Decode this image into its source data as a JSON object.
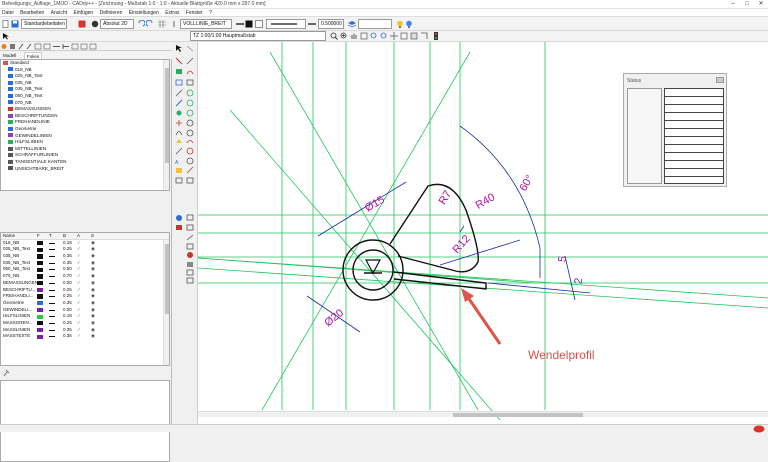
{
  "window": {
    "title": "Befestigungs_Auflage_1MOD - CADdy++ - [Zeichnung - Maßstab 1:0 : 1:0 - Aktuelle Blattgröße 420.0 mm x 297.0 mm]",
    "minimize_label": "–",
    "maximize_label": "□",
    "close_label": "✕"
  },
  "menu": [
    "Datei",
    "Bearbeiten",
    "Ansicht",
    "Einfügen",
    "Definieren",
    "Einstellungen",
    "Extras",
    "Fenster",
    "?"
  ],
  "toolbar": {
    "layer_select": "Standardebeitaten",
    "coord_select": "Absolut 2D",
    "linestyle_select": "VOLLLINIE_BREIT",
    "linewidth_value": "0.500000"
  },
  "toolbar2": {
    "scale_select": "TZ 1:00/1:00 Hauptmaßstab"
  },
  "panel": {
    "tabs": [
      "Modell",
      "Folien"
    ],
    "tree_items": [
      {
        "label": "Standard",
        "color": "#d9534f",
        "indent": 0
      },
      {
        "label": "018_NB",
        "color": "#2b6cd4",
        "indent": 1
      },
      {
        "label": "025_NB_Text",
        "color": "#2b6cd4",
        "indent": 1
      },
      {
        "label": "035_NB",
        "color": "#2b6cd4",
        "indent": 1
      },
      {
        "label": "035_NB_Text",
        "color": "#2b6cd4",
        "indent": 1
      },
      {
        "label": "050_NB_Text",
        "color": "#2b6cd4",
        "indent": 1
      },
      {
        "label": "070_NB",
        "color": "#2b6cd4",
        "indent": 1
      },
      {
        "label": "BEMASSUNGEN",
        "color": "#c0392b",
        "indent": 1
      },
      {
        "label": "BESCHRIFTUNGEN",
        "color": "#8e44ad",
        "indent": 1
      },
      {
        "label": "FREIHANDLINIE",
        "color": "#27ae60",
        "indent": 1
      },
      {
        "label": "Geometrie",
        "color": "#2b6cd4",
        "indent": 1
      },
      {
        "label": "GEWINDELINIEN",
        "color": "#8e44ad",
        "indent": 1
      },
      {
        "label": "HILFSLINIEN",
        "color": "#27ae60",
        "indent": 1
      },
      {
        "label": "MITTELLINIEN",
        "color": "#555555",
        "indent": 1
      },
      {
        "label": "SCHRAFFURLINIEN",
        "color": "#555555",
        "indent": 1
      },
      {
        "label": "TANGENTIALE KANTEN",
        "color": "#555555",
        "indent": 1
      },
      {
        "label": "UNSICHTBARE_BREIT",
        "color": "#555555",
        "indent": 1
      }
    ],
    "grid_header": {
      "name": "Name",
      "f": "F",
      "t": "T",
      "b": "B",
      "a": "A",
      "s": "S"
    },
    "grid_rows": [
      {
        "name": "018_NB",
        "color": "#111111",
        "b": "0.18"
      },
      {
        "name": "025_NB_Text",
        "color": "#111111",
        "b": "0.25"
      },
      {
        "name": "035_NB",
        "color": "#111111",
        "b": "0.35"
      },
      {
        "name": "035_NB_Text",
        "color": "#111111",
        "b": "0.35"
      },
      {
        "name": "050_NB_Text",
        "color": "#111111",
        "b": "0.50"
      },
      {
        "name": "070_NB",
        "color": "#111111",
        "b": "0.70"
      },
      {
        "name": "BEMASSUNGEN",
        "color": "#111111",
        "b": "0.00"
      },
      {
        "name": "BESCHRIFTU...",
        "color": "#7b1fa2",
        "b": "0.25"
      },
      {
        "name": "FREIHANDLI...",
        "color": "#111111",
        "b": "0.25"
      },
      {
        "name": "Geometrie",
        "color": "#2b6cd4",
        "b": "0.35"
      },
      {
        "name": "GEWINDELI...",
        "color": "#7b1fa2",
        "b": "0.00"
      },
      {
        "name": "HILFSLINIEN",
        "color": "#27c93f",
        "b": "0.18"
      },
      {
        "name": "MASSGREN...",
        "color": "#111111",
        "b": "0.25"
      },
      {
        "name": "MASSLINIEN",
        "color": "#7b1fa2",
        "b": "0.35"
      },
      {
        "name": "MASSTEXTE",
        "color": "#7b1fa2",
        "b": "0.35"
      }
    ]
  },
  "drawing": {
    "dim_labels": [
      "Ø15",
      "R7",
      "R40",
      "60°",
      "R12",
      "5",
      "2",
      "Ø20"
    ],
    "annotation": "Wendelprofil",
    "dim_color": "#b0169e",
    "geometry_color": "#111111",
    "construction_color": "#22c55e",
    "dimline_color": "#1a2aa8",
    "arrow_color": "#e0524c"
  },
  "status_window": {
    "title": "Status",
    "rows": 11
  }
}
